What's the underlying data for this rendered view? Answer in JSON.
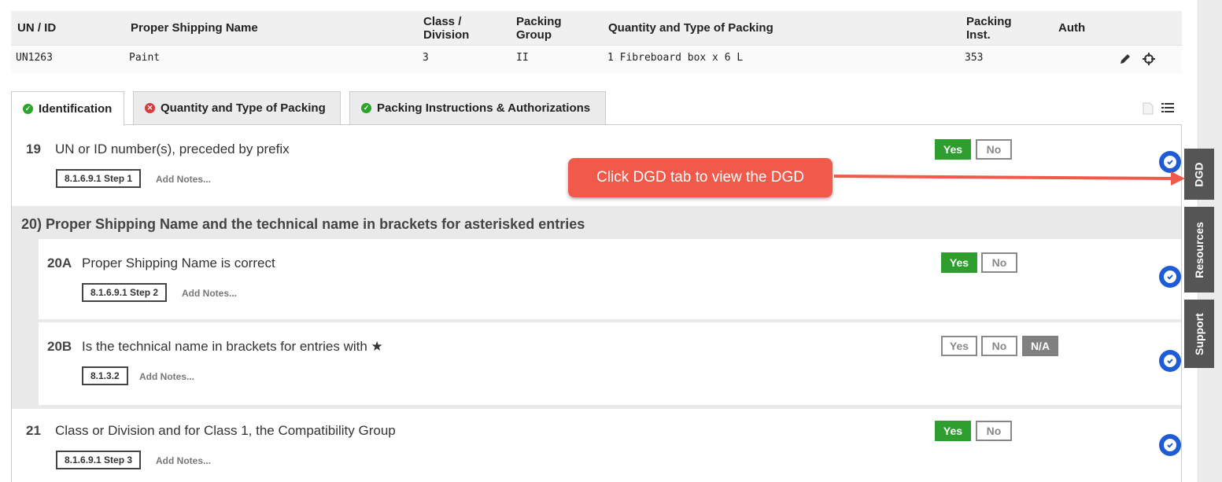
{
  "summary": {
    "headers": {
      "un_id": "UN / ID",
      "psn": "Proper Shipping Name",
      "class_line1": "Class /",
      "class_line2": "Division",
      "pg_line1": "Packing",
      "pg_line2": "Group",
      "qty": "Quantity and Type of Packing",
      "pi_line1": "Packing",
      "pi_line2": "Inst.",
      "auth": "Auth"
    },
    "row": {
      "un_id": "UN1263",
      "psn": "Paint",
      "class": "3",
      "pg": "II",
      "qty": "1 Fibreboard box x 6 L",
      "pi": "353",
      "auth": ""
    }
  },
  "tabs": [
    {
      "label": "Identification",
      "status": "ok"
    },
    {
      "label": "Quantity and Type of Packing",
      "status": "error"
    },
    {
      "label": "Packing Instructions & Authorizations",
      "status": "ok"
    }
  ],
  "questions": {
    "q19": {
      "num": "19",
      "text": "UN or ID number(s), preceded by prefix",
      "ref": "8.1.6.9.1 Step 1",
      "notes": "Add Notes...",
      "selected": "Yes"
    },
    "section20": {
      "title": "20) Proper Shipping Name and the technical name in brackets for asterisked entries"
    },
    "q20a": {
      "num": "20A",
      "text": "Proper Shipping Name is correct",
      "ref": "8.1.6.9.1 Step 2",
      "notes": "Add Notes...",
      "selected": "Yes"
    },
    "q20b": {
      "num": "20B",
      "text": "Is the technical name in brackets for entries with ★",
      "ref": "8.1.3.2",
      "notes": "Add Notes...",
      "selected": "N/A"
    },
    "q21": {
      "num": "21",
      "text": "Class or Division and for Class 1, the Compatibility Group",
      "ref": "8.1.6.9.1 Step 3",
      "notes": "Add Notes...",
      "selected": "Yes"
    }
  },
  "buttons": {
    "yes": "Yes",
    "no": "No",
    "na": "N/A"
  },
  "callout": {
    "text": "Click DGD tab to view the DGD"
  },
  "side_tabs": {
    "dgd": "DGD",
    "resources": "Resources",
    "support": "Support"
  },
  "colors": {
    "yes": "#2e9e2e",
    "callout": "#f15a4a",
    "check": "#1e5bd6",
    "side_tab": "#555555"
  }
}
